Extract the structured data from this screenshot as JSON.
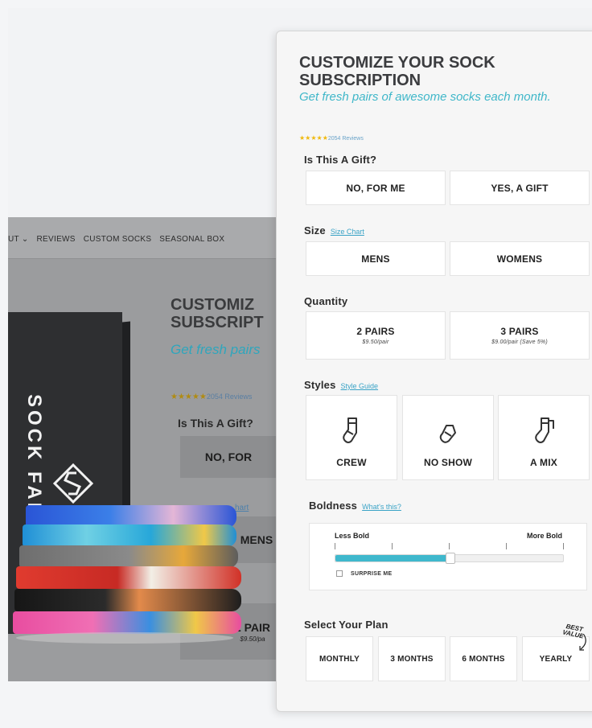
{
  "background": {
    "nav": [
      "UT",
      "REVIEWS",
      "CUSTOM SOCKS",
      "SEASONAL BOX"
    ],
    "brand": "SOCK FANC",
    "title": "CUSTOMIZ\nSUBSCRIPT",
    "subtitle": "Get fresh pairs",
    "stars": "★★★★★",
    "reviews": "2054 Reviews",
    "gift_label": "Is This A Gift?",
    "gift_option": "NO, FOR",
    "size_link": "hart",
    "size_option": "MENS",
    "qty_option": "2 PAIR",
    "qty_price": "$9.50/pa"
  },
  "modal": {
    "title": "CUSTOMIZE YOUR SOCK\nSUBSCRIPTION",
    "subtitle": "Get fresh pairs of awesome socks each month.",
    "stars": "★★★★★",
    "reviews": "2054 Reviews",
    "gift": {
      "label": "Is This A Gift?",
      "options": [
        "NO, FOR ME",
        "YES, A GIFT"
      ]
    },
    "size": {
      "label": "Size",
      "link": "Size Chart",
      "options": [
        "MENS",
        "WOMENS"
      ]
    },
    "quantity": {
      "label": "Quantity",
      "options": [
        {
          "label": "2 PAIRS",
          "price": "$9.50/pair"
        },
        {
          "label": "3 PAIRS",
          "price": "$9.00/pair (Save 5%)"
        }
      ]
    },
    "styles": {
      "label": "Styles",
      "link": "Style Guide",
      "options": [
        {
          "label": "CREW",
          "icon": "crew-sock-icon"
        },
        {
          "label": "NO SHOW",
          "icon": "no-show-sock-icon"
        },
        {
          "label": "A MIX",
          "icon": "mixed-socks-icon"
        }
      ]
    },
    "boldness": {
      "label": "Boldness",
      "link": "What's this?",
      "less": "Less Bold",
      "more": "More Bold",
      "value_fraction": 0.5,
      "surprise_label": "SURPRISE ME",
      "surprise_checked": false
    },
    "plan": {
      "label": "Select Your Plan",
      "options": [
        "MONTHLY",
        "3 MONTHS",
        "6 MONTHS",
        "YEARLY"
      ],
      "badge": "BEST\nVALUE"
    }
  },
  "colors": {
    "accent": "#3fb8cd",
    "star": "#f0b90d",
    "title": "#3b3c3f"
  }
}
